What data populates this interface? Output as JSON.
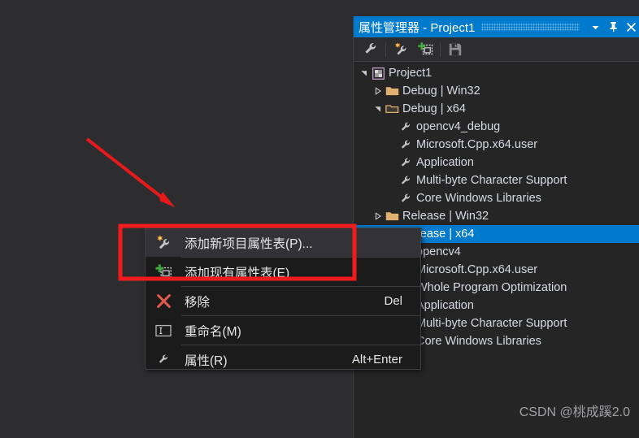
{
  "window": {
    "title": "属性管理器 - Project1",
    "buttons": [
      {
        "name": "dropdown",
        "icon": "chevron-down-icon"
      },
      {
        "name": "pin",
        "icon": "pin-icon"
      },
      {
        "name": "close",
        "icon": "close-icon"
      }
    ],
    "accent_color": "#007acc",
    "background_color": "#252526"
  },
  "toolbar": {
    "items": [
      {
        "name": "properties",
        "icon": "wrench-icon"
      },
      {
        "name": "add-new-property-sheet",
        "icon": "wrench-star-icon"
      },
      {
        "name": "add-existing-property-sheet",
        "icon": "add-sheet-icon"
      },
      {
        "name": "save",
        "icon": "save-icon"
      }
    ]
  },
  "tree": {
    "rows": [
      {
        "label": "Project1",
        "indent": 0,
        "expander": "expanded",
        "icon": "project-icon"
      },
      {
        "label": "Debug | Win32",
        "indent": 1,
        "expander": "collapsed",
        "icon": "folder-closed-icon"
      },
      {
        "label": "Debug | x64",
        "indent": 1,
        "expander": "expanded",
        "icon": "folder-open-icon"
      },
      {
        "label": "opencv4_debug",
        "indent": 2,
        "expander": "none",
        "icon": "wrench-icon"
      },
      {
        "label": "Microsoft.Cpp.x64.user",
        "indent": 2,
        "expander": "none",
        "icon": "wrench-icon"
      },
      {
        "label": "Application",
        "indent": 2,
        "expander": "none",
        "icon": "wrench-icon"
      },
      {
        "label": "Multi-byte Character Support",
        "indent": 2,
        "expander": "none",
        "icon": "wrench-icon"
      },
      {
        "label": "Core Windows Libraries",
        "indent": 2,
        "expander": "none",
        "icon": "wrench-icon"
      },
      {
        "label": "Release | Win32",
        "indent": 1,
        "expander": "collapsed",
        "icon": "folder-closed-icon"
      },
      {
        "label": "Release | x64",
        "indent": 1,
        "expander": "expanded",
        "icon": "folder-open-icon",
        "selected": true
      },
      {
        "label": "opencv4",
        "indent": 2,
        "expander": "none",
        "icon": "wrench-icon"
      },
      {
        "label": "Microsoft.Cpp.x64.user",
        "indent": 2,
        "expander": "none",
        "icon": "wrench-icon"
      },
      {
        "label": "Whole Program Optimization",
        "indent": 2,
        "expander": "none",
        "icon": "wrench-icon"
      },
      {
        "label": "Application",
        "indent": 2,
        "expander": "none",
        "icon": "wrench-icon"
      },
      {
        "label": "Multi-byte Character Support",
        "indent": 2,
        "expander": "none",
        "icon": "wrench-icon"
      },
      {
        "label": "Core Windows Libraries",
        "indent": 2,
        "expander": "none",
        "icon": "wrench-icon"
      }
    ]
  },
  "context_menu": {
    "items": [
      {
        "label": "添加新项目属性表(P)...",
        "shortcut": "",
        "icon": "wrench-star-icon",
        "highlighted": true
      },
      {
        "label": "添加现有属性表(E)",
        "shortcut": "",
        "icon": "add-sheet-icon",
        "highlighted": false
      },
      {
        "label": "移除",
        "shortcut": "Del",
        "icon": "remove-x-icon",
        "highlighted": false
      },
      {
        "label": "重命名(M)",
        "shortcut": "",
        "icon": "rename-icon",
        "highlighted": false
      },
      {
        "label": "属性(R)",
        "shortcut": "Alt+Enter",
        "icon": "wrench-icon",
        "highlighted": false
      }
    ]
  },
  "annotations": {
    "arrow": {
      "name": "red-arrow",
      "color": "#e8191b"
    },
    "highlight_box": {
      "name": "red-highlight-box",
      "color": "#f01b1d"
    }
  },
  "watermark": {
    "text": "CSDN @桃成蹊2.0"
  }
}
